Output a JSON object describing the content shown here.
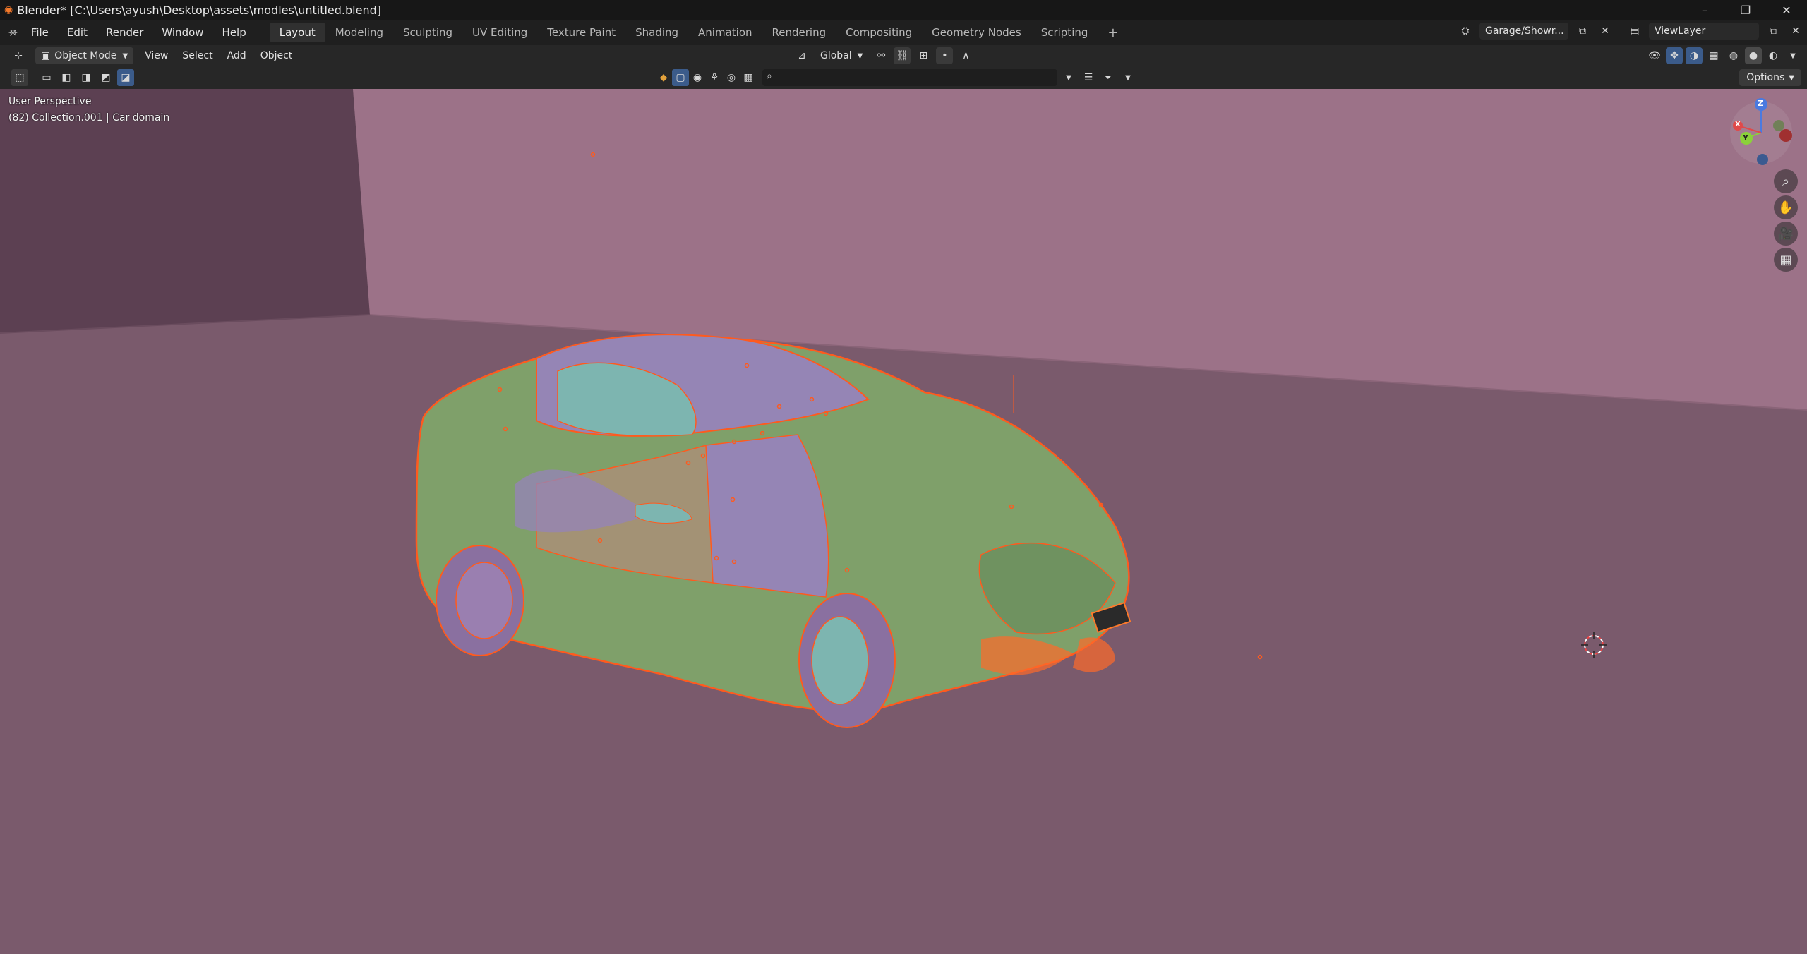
{
  "titlebar": {
    "title": "Blender* [C:\\Users\\ayush\\Desktop\\assets\\modles\\untitled.blend]",
    "minimize": "–",
    "maximize": "❐",
    "close": "✕"
  },
  "menu": {
    "file": "File",
    "edit": "Edit",
    "render": "Render",
    "window": "Window",
    "help": "Help"
  },
  "workspaces": [
    "Layout",
    "Modeling",
    "Sculpting",
    "UV Editing",
    "Texture Paint",
    "Shading",
    "Animation",
    "Rendering",
    "Compositing",
    "Geometry Nodes",
    "Scripting"
  ],
  "workspace_add": "+",
  "scene": {
    "name": "Garage/Showr...",
    "view_layer": "ViewLayer"
  },
  "header": {
    "mode": "Object Mode",
    "view": "View",
    "select": "Select",
    "add": "Add",
    "object": "Object",
    "orientation": "Global"
  },
  "toolbar": {
    "options": "Options",
    "search_placeholder": ""
  },
  "viewport": {
    "perspective": "User Perspective",
    "collection": "(82) Collection.001 | Car domain",
    "gizmo": {
      "z": "Z",
      "y": "Y",
      "x": "X"
    },
    "wall_color": "#9c7288",
    "floor_color": "#7a5a6c",
    "body_color": "#7fa06a",
    "outline_color": "#ff5a1e"
  },
  "icons": [
    "blender-logo-icon",
    "editor-type-icon",
    "object-mode-icon",
    "select-box-icon",
    "transform-pivot-icon",
    "snap-icon",
    "proportional-icon",
    "filter-icon",
    "zoom-icon",
    "hand-pan-icon",
    "camera-view-icon",
    "grid-ortho-icon",
    "3d-cursor-icon"
  ]
}
